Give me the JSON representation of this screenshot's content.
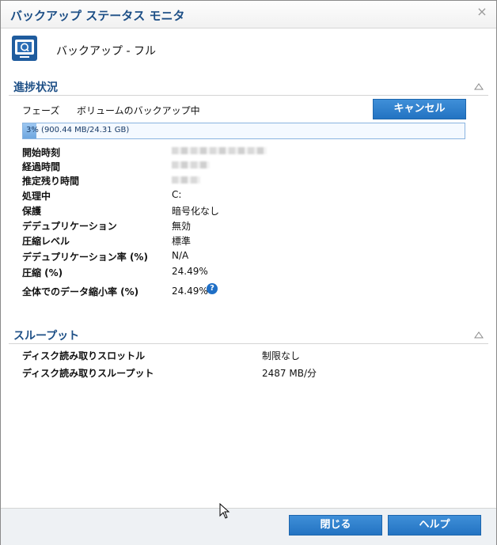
{
  "window": {
    "title": "バックアップ ステータス モニタ",
    "close_glyph": "×"
  },
  "header": {
    "icon": "backup-monitor-icon",
    "text": "バックアップ - フル"
  },
  "progress_section": {
    "title": "進捗状況",
    "phase_label": "フェーズ",
    "phase_value": "ボリュームのバックアップ中",
    "cancel_label": "キャンセル",
    "progress_percent": 3,
    "progress_text": "3% (900.44 MB/24.31 GB)",
    "rows": [
      {
        "label": "開始時刻",
        "value": ""
      },
      {
        "label": "経過時間",
        "value": ""
      },
      {
        "label": "推定残り時間",
        "value": ""
      },
      {
        "label": "処理中",
        "value": "C:"
      },
      {
        "label": "保護",
        "value": "暗号化なし"
      },
      {
        "label": "デデュプリケーション",
        "value": "無効"
      },
      {
        "label": "圧縮レベル",
        "value": "標準"
      },
      {
        "label": "デデュプリケーション率 (%)",
        "value": "N/A"
      },
      {
        "label": "圧縮 (%)",
        "value": "24.49%"
      },
      {
        "label": "全体でのデータ縮小率 (%)",
        "value": "24.49%"
      }
    ]
  },
  "throughput_section": {
    "title": "スループット",
    "rows": [
      {
        "label": "ディスク読み取りスロットル",
        "value": "制限なし"
      },
      {
        "label": "ディスク読み取りスループット",
        "value": "2487 MB/分"
      }
    ]
  },
  "footer": {
    "close_label": "閉じる",
    "help_label": "ヘルプ"
  },
  "help_glyph": "?",
  "colors": {
    "accent": "#1d4f86",
    "button": "#2f80cc",
    "progress": "#7fb2e6"
  }
}
